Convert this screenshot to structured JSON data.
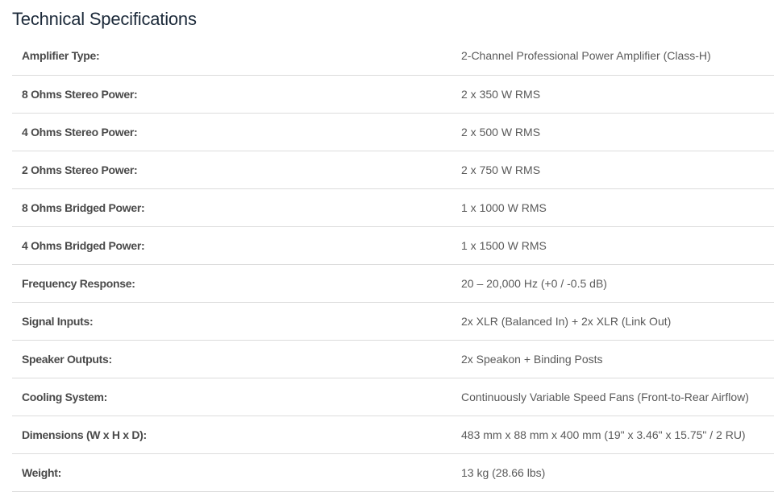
{
  "title": "Technical Specifications",
  "specs": [
    {
      "label": "Amplifier Type:",
      "value": "2-Channel Professional Power Amplifier (Class-H)"
    },
    {
      "label": "8 Ohms Stereo Power:",
      "value": "2 x 350 W RMS"
    },
    {
      "label": "4 Ohms Stereo Power:",
      "value": "2 x 500 W RMS"
    },
    {
      "label": "2 Ohms Stereo Power:",
      "value": "2 x 750 W RMS"
    },
    {
      "label": "8 Ohms Bridged Power:",
      "value": "1 x 1000 W RMS"
    },
    {
      "label": "4 Ohms Bridged Power:",
      "value": "1 x 1500 W RMS"
    },
    {
      "label": "Frequency Response:",
      "value": "20 – 20,000 Hz (+0 / -0.5 dB)"
    },
    {
      "label": "Signal Inputs:",
      "value": "2x XLR (Balanced In) + 2x XLR (Link Out)"
    },
    {
      "label": "Speaker Outputs:",
      "value": "2x Speakon + Binding Posts"
    },
    {
      "label": "Cooling System:",
      "value": "Continuously Variable Speed Fans (Front-to-Rear Airflow)"
    },
    {
      "label": "Dimensions (W x H x D):",
      "value": "483 mm x 88 mm x 400 mm (19\" x 3.46\" x 15.75\" / 2 RU)"
    },
    {
      "label": "Weight:",
      "value": "13 kg (28.66 lbs)"
    }
  ]
}
